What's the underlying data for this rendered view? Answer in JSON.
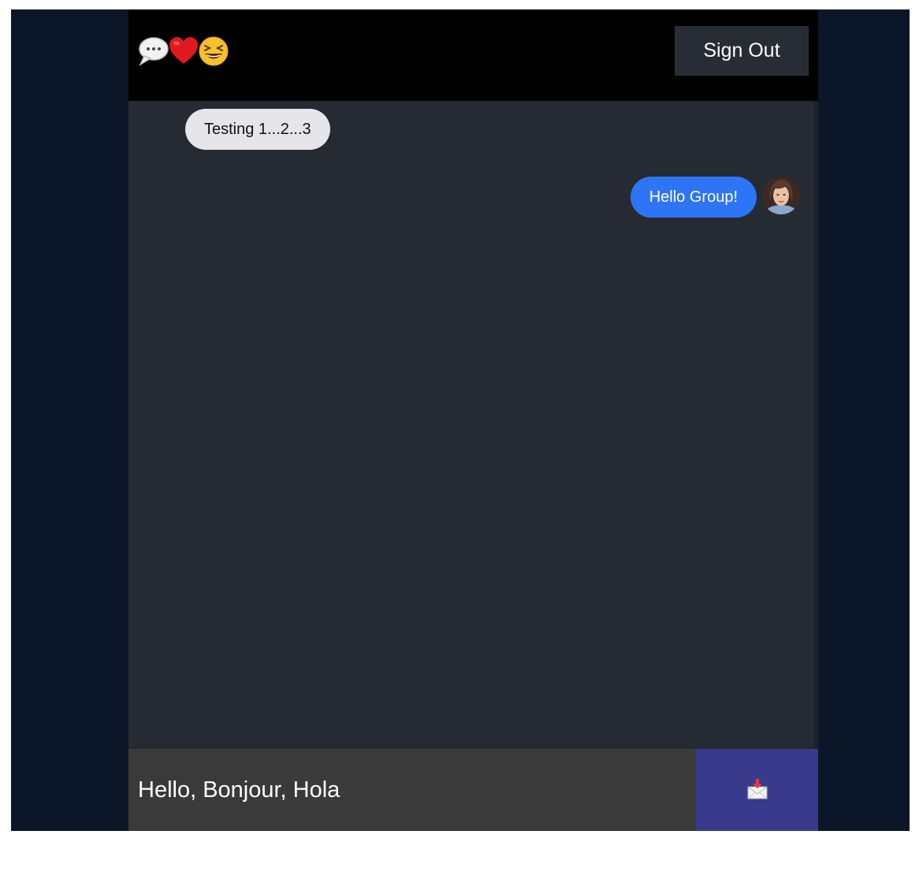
{
  "header": {
    "logo_icons": [
      "speech-bubble-icon",
      "red-heart-icon",
      "grinning-squinting-face-icon"
    ],
    "sign_out_label": "Sign Out"
  },
  "messages": [
    {
      "type": "received",
      "text": "Testing 1...2...3"
    },
    {
      "type": "sent",
      "text": "Hello Group!",
      "avatar": "user-avatar"
    }
  ],
  "composer": {
    "input_value": "Hello, Bonjour, Hola",
    "send_icon": "envelope-with-arrow-icon"
  },
  "colors": {
    "page_background": "#0b1728",
    "header_background": "#000000",
    "chat_background": "#262a33",
    "sign_out_background": "#282c34",
    "received_bubble": "#e5e5ea",
    "sent_bubble": "#2e75f6",
    "input_background": "#3a3a3a",
    "send_button": "#3a3a8c"
  }
}
